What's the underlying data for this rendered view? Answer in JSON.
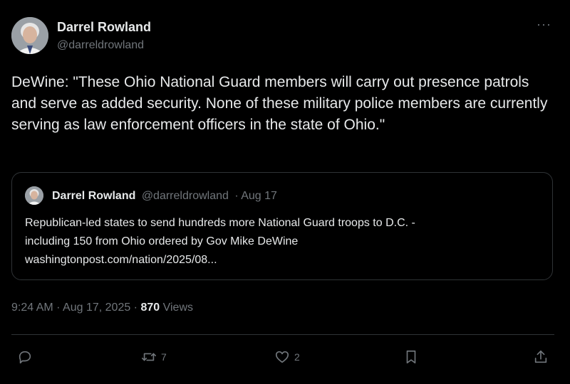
{
  "tweet": {
    "author_name": "Darrel Rowland",
    "author_handle": "@darreldrowland",
    "more_label": "···",
    "text": "DeWine: \"These Ohio National Guard members will carry out presence patrols and serve as added security.  None of these military police members are currently serving as law enforcement officers in the state of Ohio.\"",
    "time": "9:24 AM · Aug 17, 2025 · ",
    "views_count": "870",
    "views_label": " Views"
  },
  "quote": {
    "author_name": "Darrel Rowland",
    "author_handle": "@darreldrowland",
    "date": "· Aug 17",
    "line1": "Republican-led states to send hundreds more National Guard troops to D.C. -",
    "line2": "including 150 from Ohio ordered by Gov Mike DeWine",
    "line3": "washingtonpost.com/nation/2025/08..."
  },
  "actions": {
    "reply_count": "",
    "retweet_count": "7",
    "like_count": "2"
  },
  "icons": {
    "reply": "reply-icon",
    "retweet": "retweet-icon",
    "like": "heart-icon",
    "bookmark": "bookmark-icon",
    "share": "share-icon"
  },
  "colors": {
    "background": "#000000",
    "text": "#e7e9ea",
    "muted": "#71767b",
    "border": "#2f3336"
  }
}
